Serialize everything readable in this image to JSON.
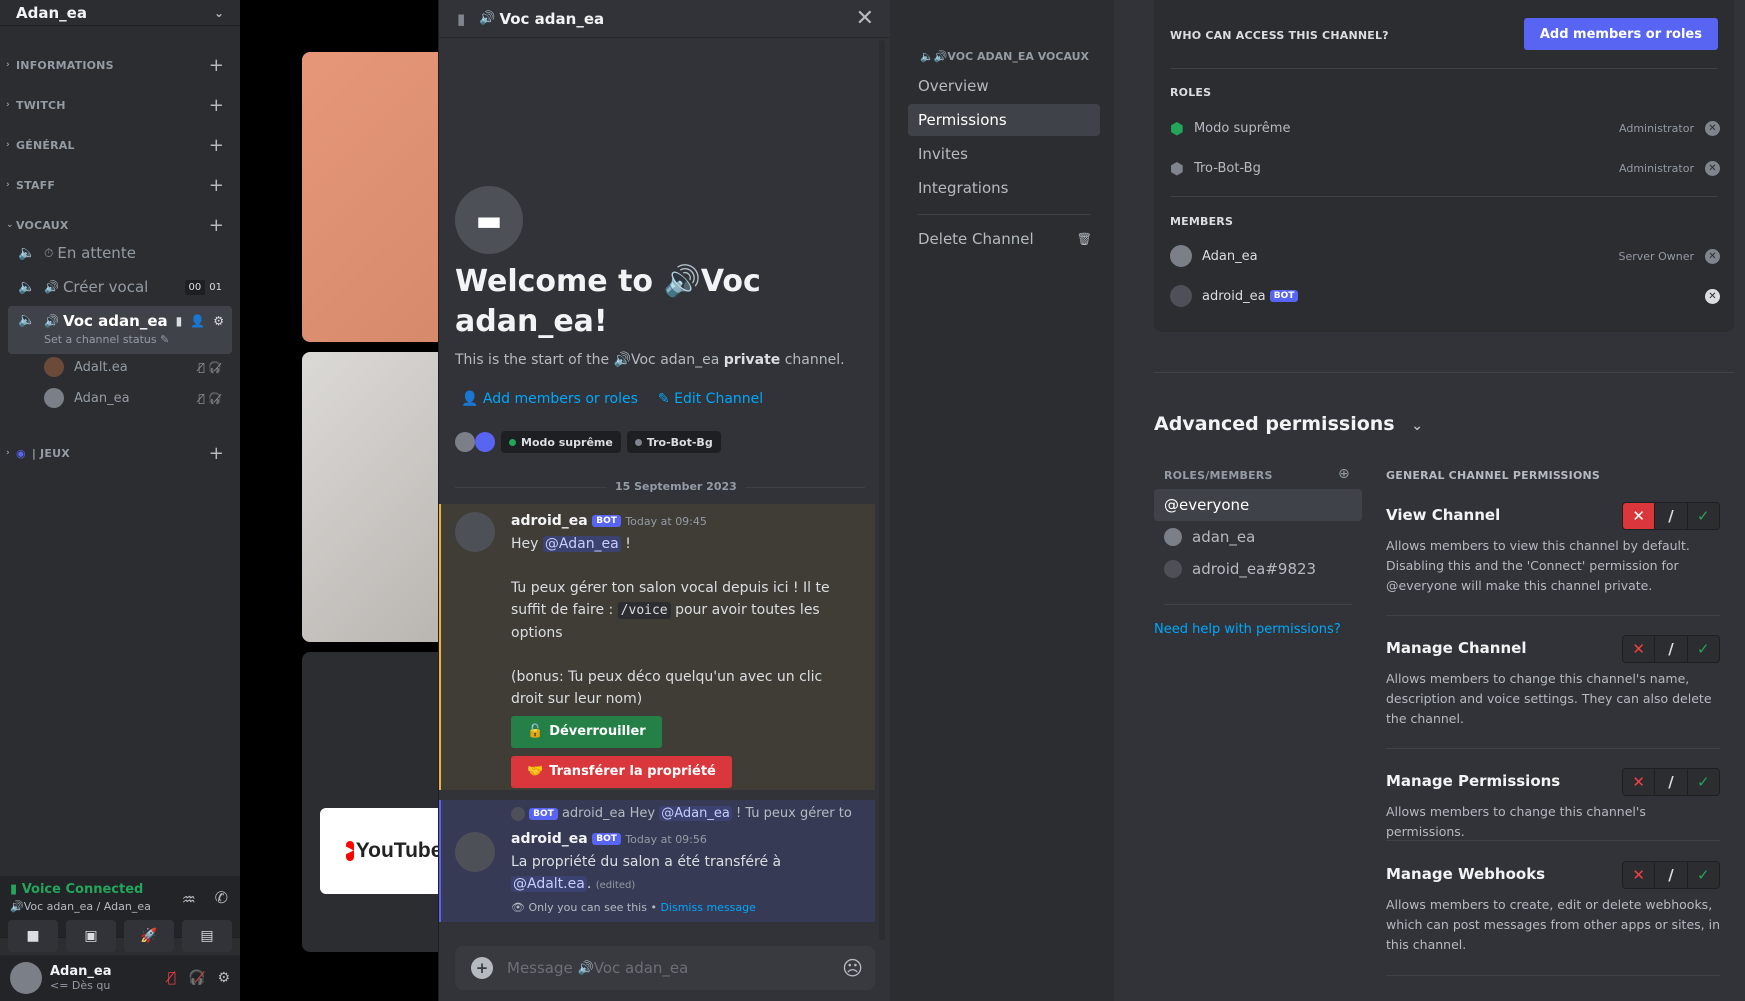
{
  "server": {
    "name": "Adan_ea"
  },
  "categories": [
    {
      "label": "INFORMATIONS"
    },
    {
      "label": "TWITCH"
    },
    {
      "label": "GÉNÉRAL"
    },
    {
      "label": "STAFF"
    },
    {
      "label": "VOCAUX"
    },
    {
      "label": "| JEUX"
    }
  ],
  "channels": {
    "attente": "En attente",
    "creer": "Créer vocal",
    "creer_count_a": "00",
    "creer_count_b": "01",
    "current": "Voc adan_ea",
    "current_status": "Set a channel status"
  },
  "voice_users": [
    {
      "name": "Adalt.ea"
    },
    {
      "name": "Adan_ea"
    }
  ],
  "voice_connected": {
    "title": "Voice Connected",
    "subtitle": "Voc adan_ea / Adan_ea"
  },
  "user_area": {
    "name": "Adan_ea",
    "status": "<= Dès qu"
  },
  "background": {
    "youtube_label": "YouTube"
  },
  "chat": {
    "title": "Voc adan_ea",
    "welcome_a": "Welcome to",
    "welcome_b": "Voc",
    "welcome_c": "adan_ea!",
    "start_text_a": "This is the start of the",
    "start_text_channel": "Voc adan_ea",
    "start_text_private": "private",
    "start_text_b": "channel.",
    "add_members": "Add members or roles",
    "edit_channel": "Edit Channel",
    "role_1": "Modo suprême",
    "role_2": "Tro-Bot-Bg",
    "date_divider": "15 September 2023",
    "msg1": {
      "author": "adroid_ea",
      "bot": "BOT",
      "time": "Today at 09:45",
      "hey": "Hey",
      "mention": "@Adan_ea",
      "excl": "!",
      "line2a": "Tu peux gérer ton salon vocal depuis ici ! Il te",
      "line2b": "suffit de faire :",
      "code": "/voice",
      "line2c": "pour avoir toutes les",
      "line2d": "options",
      "line3a": "(bonus: Tu peux déco quelqu'un avec un clic",
      "line3b": "droit sur leur nom)",
      "btn_unlock": "Déverrouiller",
      "btn_transfer": "Transférer la propriété"
    },
    "msg2": {
      "reply_bot": "BOT",
      "reply_author": "adroid_ea",
      "reply_text_a": "Hey",
      "reply_mention": "@Adan_ea",
      "reply_text_b": "! Tu peux gérer to",
      "author": "adroid_ea",
      "bot": "BOT",
      "time": "Today at 09:56",
      "line1": "La propriété du salon a été transféré à",
      "mention": "@Adalt.ea",
      "dot": ".",
      "edited": "(edited)",
      "ephemeral": "Only you can see this •",
      "dismiss": "Dismiss message"
    },
    "input_placeholder_a": "Message",
    "input_placeholder_b": "Voc adan_ea"
  },
  "settings_nav": {
    "header": "VOC ADAN_EA VOCAUX",
    "items": [
      {
        "label": "Overview"
      },
      {
        "label": "Permissions"
      },
      {
        "label": "Invites"
      },
      {
        "label": "Integrations"
      }
    ],
    "delete": "Delete Channel"
  },
  "access": {
    "title": "WHO CAN ACCESS THIS CHANNEL?",
    "add_button": "Add members or roles",
    "roles_label": "ROLES",
    "roles": [
      {
        "name": "Modo suprême",
        "tag": "Administrator",
        "color": "#23a55a"
      },
      {
        "name": "Tro-Bot-Bg",
        "tag": "Administrator",
        "color": "#80848e"
      }
    ],
    "members_label": "MEMBERS",
    "members": [
      {
        "name": "Adan_ea",
        "tag": "Server Owner"
      },
      {
        "name": "adroid_ea",
        "tag": "",
        "bot": "BOT"
      }
    ]
  },
  "advanced": {
    "title": "Advanced permissions",
    "roles_members_label": "ROLES/MEMBERS",
    "list": [
      {
        "name": "@everyone"
      },
      {
        "name": "adan_ea"
      },
      {
        "name": "adroid_ea#9823"
      }
    ],
    "help_link": "Need help with permissions?",
    "general_label": "GENERAL CHANNEL PERMISSIONS",
    "perms": [
      {
        "title": "View Channel",
        "desc": "Allows members to view this channel by default. Disabling this and the 'Connect' permission for @everyone will make this channel private.",
        "state": "deny"
      },
      {
        "title": "Manage Channel",
        "desc": "Allows members to change this channel's name, description and voice settings. They can also delete the channel.",
        "state": "neutral"
      },
      {
        "title": "Manage Permissions",
        "desc": "Allows members to change this channel's permissions.",
        "state": "neutral"
      },
      {
        "title": "Manage Webhooks",
        "desc": "Allows members to create, edit or delete webhooks, which can post messages from other apps or sites, in this channel.",
        "state": "neutral"
      }
    ]
  },
  "colors": {
    "blurple": "#5865f2",
    "green": "#248046",
    "red": "#da373c",
    "link": "#00a8fc"
  }
}
